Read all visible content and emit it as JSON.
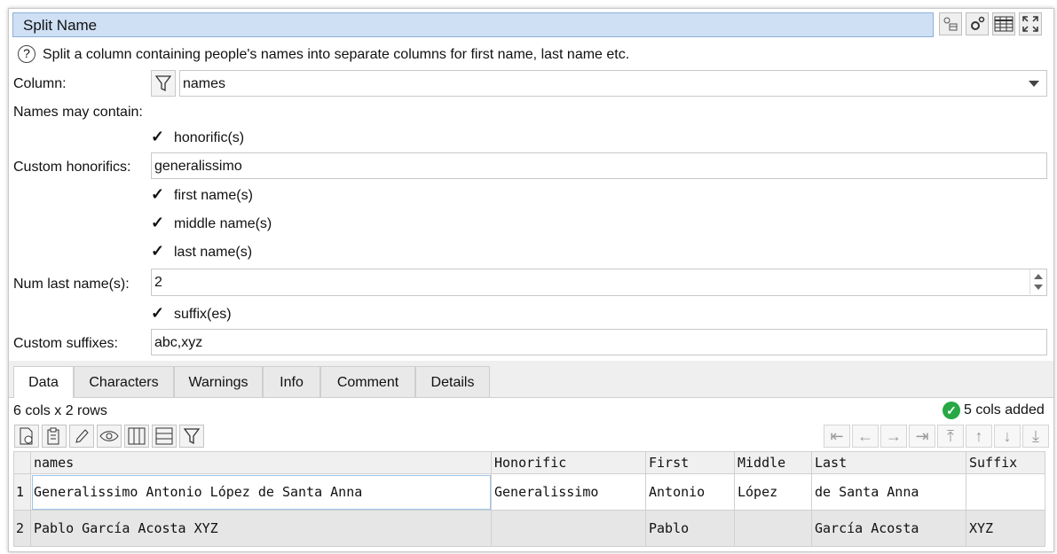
{
  "window": {
    "title": "Split Name"
  },
  "title_icons": [
    "transform-icon",
    "settings-icon",
    "table-icon",
    "fullscreen-icon"
  ],
  "description": "Split a column containing people's names into separate columns for first name, last name etc.",
  "form": {
    "column_label": "Column:",
    "column_value": "names",
    "names_may_contain_label": "Names may contain:",
    "honorifics_label": "honorific(s)",
    "custom_honorifics_label": "Custom honorifics:",
    "custom_honorifics_value": "generalissimo",
    "first_label": "first name(s)",
    "middle_label": "middle name(s)",
    "last_label": "last name(s)",
    "num_last_label": "Num last name(s):",
    "num_last_value": "2",
    "suffixes_label": "suffix(es)",
    "custom_suffixes_label": "Custom suffixes:",
    "custom_suffixes_value": "abc,xyz",
    "check_mark": "✓"
  },
  "tabs": [
    "Data",
    "Characters",
    "Warnings",
    "Info",
    "Comment",
    "Details"
  ],
  "status": {
    "dims": "6 cols x 2 rows",
    "result": "5 cols added",
    "ok_mark": "✓"
  },
  "nav_glyphs": [
    "⇤",
    "←",
    "→",
    "⇥",
    "⤒",
    "↑",
    "↓",
    "⤓"
  ],
  "table": {
    "headers": [
      "names",
      "Honorific",
      "First",
      "Middle",
      "Last",
      "Suffix"
    ],
    "rows": [
      {
        "num": "1",
        "cells": [
          "Generalissimo Antonio López de Santa Anna",
          "Generalissimo",
          "Antonio",
          "López",
          "de Santa Anna",
          ""
        ]
      },
      {
        "num": "2",
        "cells": [
          "Pablo García Acosta XYZ",
          "",
          "Pablo",
          "",
          "García Acosta",
          "XYZ"
        ]
      }
    ]
  },
  "colors": {
    "titlebar": "#cfe0f5",
    "ok": "#27a844",
    "selected_border": "#9fc3ea"
  }
}
